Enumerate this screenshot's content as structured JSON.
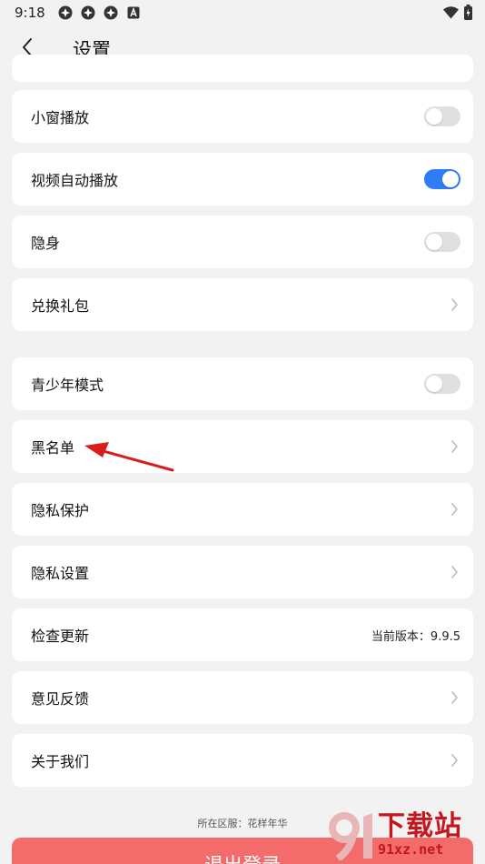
{
  "status_bar": {
    "time": "9:18",
    "icons": [
      "app-notification-icon",
      "app-notification-icon",
      "app-notification-icon",
      "keyboard-a-icon"
    ],
    "right_icons": [
      "wifi-icon",
      "battery-icon"
    ]
  },
  "header": {
    "title": "设置"
  },
  "items": [
    {
      "label": "小窗播放",
      "type": "toggle",
      "on": false
    },
    {
      "label": "视频自动播放",
      "type": "toggle",
      "on": true
    },
    {
      "label": "隐身",
      "type": "toggle",
      "on": false
    },
    {
      "label": "兑换礼包",
      "type": "link"
    },
    {
      "label": "青少年模式",
      "type": "toggle",
      "on": false
    },
    {
      "label": "黑名单",
      "type": "link"
    },
    {
      "label": "隐私保护",
      "type": "link"
    },
    {
      "label": "隐私设置",
      "type": "link"
    },
    {
      "label": "检查更新",
      "type": "value",
      "value": "当前版本：9.9.5"
    },
    {
      "label": "意见反馈",
      "type": "link"
    },
    {
      "label": "关于我们",
      "type": "link"
    }
  ],
  "region_text": "所在区服：花样年华",
  "logout_label": "退出登录",
  "watermark": {
    "main": "下载站",
    "url": "91xz.net"
  },
  "colors": {
    "accent": "#2e7cf6",
    "logout": "#f36b6b",
    "arrow": "#d91c1c"
  }
}
